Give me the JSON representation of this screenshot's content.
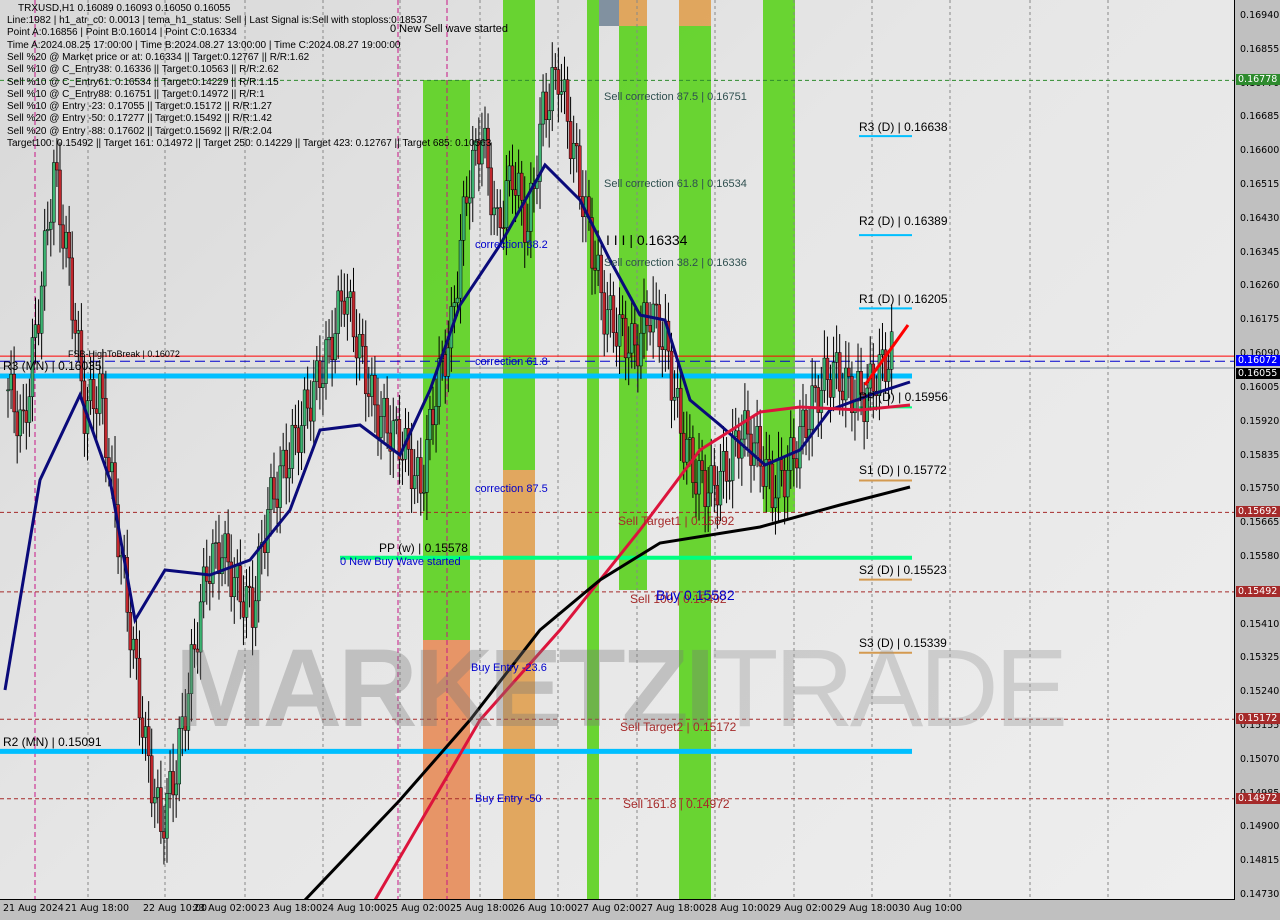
{
  "header": {
    "symbol_line": "TRXUSD,H1  0.16089 0.16093 0.16050 0.16055",
    "info_lines": [
      "Line:1982 | h1_atr_c0: 0.0013 | tema_h1_status: Sell | Last Signal is:Sell with stoploss:0.18537",
      "Point A:0.16856 | Point B:0.16014 | Point C:0.16334",
      "Time A:2024.08.25 17:00:00 | Time B:2024.08.27 13:00:00 | Time C:2024.08.27 19:00:00",
      "Sell %20 @ Market price or at: 0.16334 || Target:0.12767 || R/R:1.62",
      "Sell %10 @ C_Entry38: 0.16336 || Target:0.10563 || R/R:2.62",
      "Sell %10 @ C_Entry61: 0.16534 || Target:0.14229 || R/R:1.15",
      "Sell %10 @ C_Entry88: 0.16751 || Target:0.14972 || R/R:1",
      "Sell %10 @ Entry -23: 0.17055 || Target:0.15172 || R/R:1.27",
      "Sell %20 @ Entry -50: 0.17277 || Target:0.15492 || R/R:1.42",
      "Sell %20 @ Entry -88: 0.17602 || Target:0.15692 || R/R:2.04",
      "Target100: 0.15492 || Target 161: 0.14972 || Target 250: 0.14229 || Target 423: 0.12767 || Target 685: 0.10563"
    ]
  },
  "watermark": {
    "bold": "MARKETZI",
    "thin": "TRADE"
  },
  "colors": {
    "bull_candle": "#3cb371",
    "bear_candle": "#c0272d",
    "ma_blue": "#0a0a7a",
    "ma_red": "#dc143c",
    "ma_black": "#000000",
    "level_cyan": "#00bfff",
    "level_green": "#00ff7f",
    "zone_green": "#5bd11e",
    "zone_orange": "#e0a050",
    "zone_salmon": "#f08070",
    "target_red": "#a52a2a",
    "tag_green": "#2e8b2e",
    "tag_blue": "#0000ff",
    "tag_black": "#000000"
  },
  "chart_data": {
    "type": "candlestick",
    "title": "TRXUSD,H1",
    "ylim": [
      0.1469,
      0.1697
    ],
    "y_ticks": [
      "0.16940",
      "0.16855",
      "0.16770",
      "0.16685",
      "0.16600",
      "0.16515",
      "0.16430",
      "0.16345",
      "0.16260",
      "0.16175",
      "0.16090",
      "0.16005",
      "0.15920",
      "0.15835",
      "0.15750",
      "0.15665",
      "0.15580",
      "0.15495",
      "0.15410",
      "0.15325",
      "0.15240",
      "0.15155",
      "0.15070",
      "0.14985",
      "0.14900",
      "0.14815",
      "0.14730"
    ],
    "x_ticks": [
      "21 Aug 2024",
      "21 Aug 18:00",
      "22 Aug 10:00",
      "23 Aug 02:00",
      "23 Aug 18:00",
      "24 Aug 10:00",
      "25 Aug 02:00",
      "25 Aug 18:00",
      "26 Aug 10:00",
      "27 Aug 02:00",
      "27 Aug 18:00",
      "28 Aug 10:00",
      "29 Aug 02:00",
      "29 Aug 18:00",
      "30 Aug 10:00"
    ],
    "ohlc_last": {
      "open": 0.16089,
      "high": 0.16093,
      "low": 0.1605,
      "close": 0.16055
    },
    "price_tags": [
      {
        "value": "0.16778",
        "kind": "green"
      },
      {
        "value": "0.16072",
        "kind": "blue"
      },
      {
        "value": "0.16055",
        "kind": "black"
      },
      {
        "value": "0.15692",
        "kind": "red"
      },
      {
        "value": "0.15492",
        "kind": "red"
      },
      {
        "value": "0.15172",
        "kind": "red"
      },
      {
        "value": "0.14972",
        "kind": "red"
      }
    ],
    "levels": [
      {
        "label": "R3 (D) | 0.16638",
        "value": 0.16638
      },
      {
        "label": "R2 (D) | 0.16389",
        "value": 0.16389
      },
      {
        "label": "R1 (D) | 0.16205",
        "value": 0.16205
      },
      {
        "label": "PP (D) | 0.15956",
        "value": 0.15956
      },
      {
        "label": "S1 (D) | 0.15772",
        "value": 0.15772
      },
      {
        "label": "S2 (D) | 0.15523",
        "value": 0.15523
      },
      {
        "label": "S3 (D) | 0.15339",
        "value": 0.15339
      },
      {
        "label": "R3 (MN) | 0.16035",
        "value": 0.16035
      },
      {
        "label": "R2 (MN) | 0.15091",
        "value": 0.15091
      },
      {
        "label": "PP (w) | 0.15578",
        "value": 0.15578
      },
      {
        "label": "FSB-HighToBreak | 0.16072",
        "value": 0.16072
      }
    ],
    "annotations": [
      "0 New Sell wave started",
      "0 New Buy Wave started",
      "Sell correction 87.5 | 0.16751",
      "Sell correction 61.8 | 0.16534",
      "Sell correction 38.2 | 0.16336",
      "I I I | 0.16334",
      "correction 38.2",
      "correction 61.8",
      "correction 87.5",
      "Sell Target1 | 0.15692",
      "Sell 100 | 0.15492",
      "Buy 0.15582",
      "Sell Target2 | 0.15172",
      "Sell 161.8 | 0.14972",
      "Buy Entry -23.6",
      "Buy Entry -50"
    ]
  }
}
